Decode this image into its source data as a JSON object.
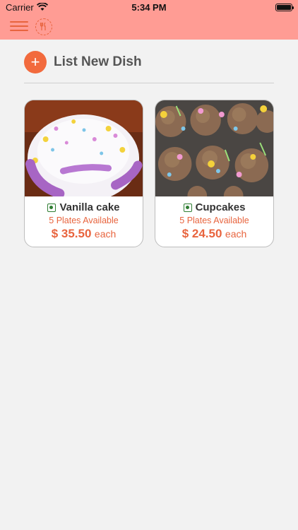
{
  "status": {
    "carrier": "Carrier",
    "time": "5:34 PM"
  },
  "header": {
    "menu_icon": "hamburger-icon",
    "logo_icon": "fork-knife-icon"
  },
  "list": {
    "add_icon": "+",
    "title": "List New Dish"
  },
  "dishes": [
    {
      "name": "Vanilla cake",
      "availability": "5 Plates Available",
      "price": "$ 35.50",
      "unit": "each",
      "veg": true
    },
    {
      "name": "Cupcakes",
      "availability": "5 Plates Available",
      "price": "$ 24.50",
      "unit": "each",
      "veg": true
    }
  ],
  "colors": {
    "header_bg": "#ff9c94",
    "accent": "#f26a3d",
    "veg_green": "#2e7d32"
  }
}
